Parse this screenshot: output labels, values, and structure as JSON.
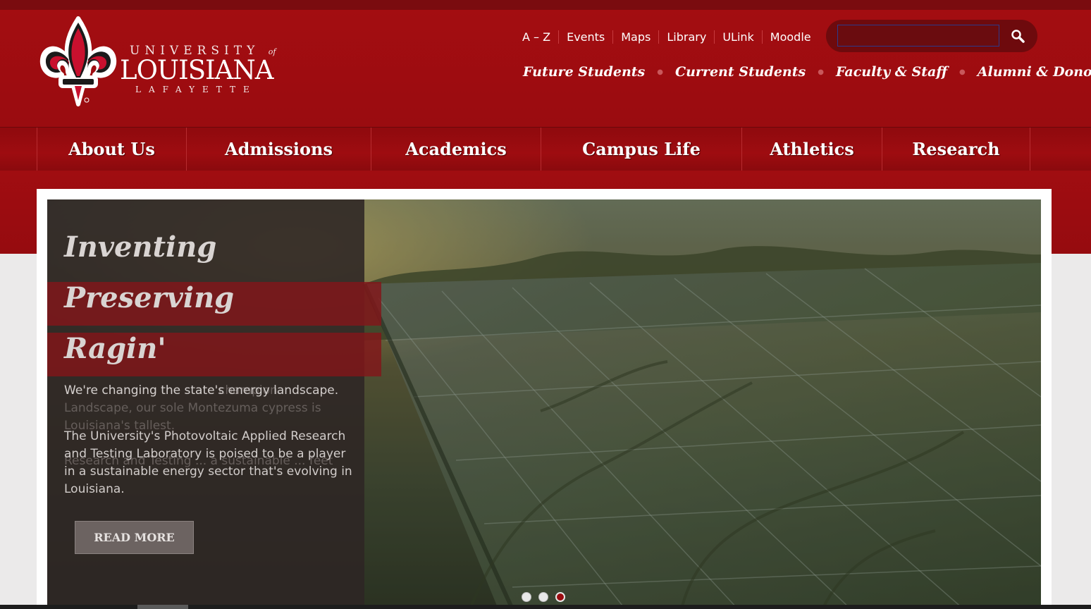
{
  "logo": {
    "university": "UNIVERSITY",
    "of": "of",
    "louisiana": "LOUISIANA",
    "lafayette": "LAFAYETTE"
  },
  "utility_links": [
    "A – Z",
    "Events",
    "Maps",
    "Library",
    "ULink",
    "Moodle"
  ],
  "search": {
    "placeholder": "",
    "value": ""
  },
  "audience_links": [
    "Future Students",
    "Current Students",
    "Faculty & Staff",
    "Alumni & Donors"
  ],
  "main_nav": [
    "About Us",
    "Admissions",
    "Academics",
    "Campus Life",
    "Athletics",
    "Research"
  ],
  "slider": {
    "headlines": [
      "Inventing",
      "Preserving",
      "Ragin'"
    ],
    "active_text": [
      "We're changing the state's energy landscape.",
      "The University's Photovoltaic Applied Research and Testing Laboratory is poised to be a player in a sustainable energy sector that's evolving in Louisiana."
    ],
    "fading_text": [
      "We're changing the state champion. Landscape, our sole Montezuma cypress is Louisiana's tallest.",
      "Research and Testing ... a sustainable ... feet"
    ],
    "read_more": "READ MORE",
    "slide_count": 3,
    "active_slide": 3
  },
  "colors": {
    "header_red": "#a30d11",
    "dark_red": "#7a0c0f",
    "panel": "#2d2624"
  },
  "icons": {
    "search": "search-icon",
    "logo": "fleur-de-lis-logo"
  }
}
